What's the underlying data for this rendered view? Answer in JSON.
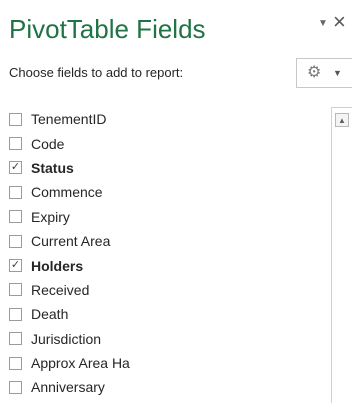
{
  "pane": {
    "title": "PivotTable Fields",
    "menu_icon": "caret-down-icon",
    "close_glyph": "×",
    "subtitle": "Choose fields to add to report:",
    "tools_icon": "gear-icon",
    "tools_caret": "caret-down-icon"
  },
  "fields": [
    {
      "label": "TenementID",
      "checked": false
    },
    {
      "label": "Code",
      "checked": false
    },
    {
      "label": "Status",
      "checked": true
    },
    {
      "label": "Commence",
      "checked": false
    },
    {
      "label": "Expiry",
      "checked": false
    },
    {
      "label": "Current Area",
      "checked": false
    },
    {
      "label": "Holders",
      "checked": true
    },
    {
      "label": "Received",
      "checked": false
    },
    {
      "label": "Death",
      "checked": false
    },
    {
      "label": "Jurisdiction",
      "checked": false
    },
    {
      "label": "Approx Area Ha",
      "checked": false
    },
    {
      "label": "Anniversary",
      "checked": false
    }
  ],
  "colors": {
    "title": "#217346",
    "text": "#262626",
    "checkbox_border": "#9b9b9b"
  }
}
